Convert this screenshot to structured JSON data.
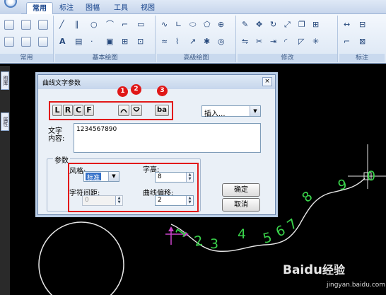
{
  "ribbon": {
    "tabs": [
      "常用",
      "标注",
      "图幅",
      "工具",
      "视图"
    ],
    "active_tab": "常用",
    "panels": [
      "常用",
      "基本绘图",
      "高级绘图",
      "修改",
      "标注"
    ]
  },
  "palette_tabs": [
    "图库",
    "属性"
  ],
  "dialog": {
    "title": "曲线文字参数",
    "close": "×",
    "align_buttons": [
      "L",
      "R",
      "C",
      "F"
    ],
    "effect_buttons": [
      "â",
      "â",
      "ba"
    ],
    "badges": [
      "1",
      "2",
      "3"
    ],
    "insert_label": "插入...",
    "text_label": "文字内容:",
    "text_value": "1234567890",
    "params": {
      "legend": "参数",
      "style_label": "风格:",
      "style_value": "标准",
      "height_label": "字高:",
      "height_value": "8",
      "spacing_label": "字符间距:",
      "spacing_value": "0",
      "offset_label": "曲线偏移:",
      "offset_value": "2"
    },
    "ok_button": "确定",
    "cancel_button": "取消"
  },
  "drawing": {
    "curve_digits": [
      "1",
      "2",
      "3",
      "4",
      "5",
      "6",
      "7",
      "8",
      "9",
      "0"
    ],
    "digit_color": "#39d24a"
  },
  "watermark": {
    "brand": "Bai",
    "paw": "du",
    "suffix": "经验",
    "url": "jingyan.baidu.com"
  },
  "colors": {
    "annotation_red": "#e21919",
    "ribbon_blue": "#c9d9ee",
    "canvas": "#000000"
  }
}
